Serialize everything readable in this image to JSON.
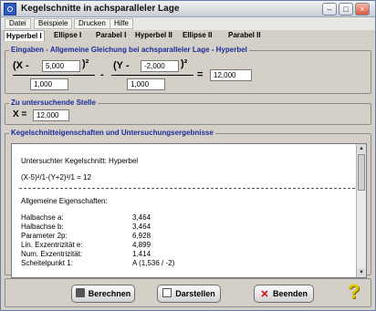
{
  "window": {
    "title": "Kegelschnitte in achsparalleler Lage"
  },
  "menu": [
    "Datei",
    "Beispiele",
    "Drucken",
    "Hilfe"
  ],
  "tabs": [
    "Hyperbel I",
    "Ellipse I",
    "Parabel I",
    "Hyperbel II",
    "Ellipse II",
    "Parabel II"
  ],
  "equation_group": {
    "legend": "Eingaben - Allgemeine Gleichung bei achsparalleler Lage - Hyperbel",
    "x_label": "(X -",
    "x_shift": "5,000",
    "x_close": ")²",
    "x_denominator": "1,000",
    "minus": "-",
    "y_label": "(Y -",
    "y_shift": "-2,000",
    "y_close": ")²",
    "y_denominator": "1,000",
    "equals": "=",
    "rhs": "12,000"
  },
  "point_group": {
    "legend": "Zu untersuchende Stelle",
    "x_label": "X =",
    "x_value": "12,000"
  },
  "results_group": {
    "legend": "Kegelschnitteigenschaften und Untersuchungsergebnisse",
    "heading": "Untersuchter Kegelschnitt: Hyperbel",
    "equation": "(X-5)²/1-(Y+2)²/1 = 12",
    "general_title": "Allgemeine Eigenschaften:",
    "rows": [
      {
        "label": "Halbachse a:",
        "value": "3,464"
      },
      {
        "label": "Halbachse b:",
        "value": "3,464"
      },
      {
        "label": "Parameter 2p:",
        "value": "6,928"
      },
      {
        "label": "Lin. Exzentrizität e:",
        "value": "4,899"
      },
      {
        "label": "Num. Exzentrizität:",
        "value": "1,414"
      },
      {
        "label": "Scheitelpunkt 1:",
        "value": "A (1,536 / -2)"
      }
    ]
  },
  "buttons": {
    "calculate": "Berechnen",
    "plot": "Darstellen",
    "exit": "Beenden"
  },
  "colors": {
    "legend": "#1c2b9c",
    "accent": "#2c59c4",
    "help_icon": "#e3c600"
  }
}
